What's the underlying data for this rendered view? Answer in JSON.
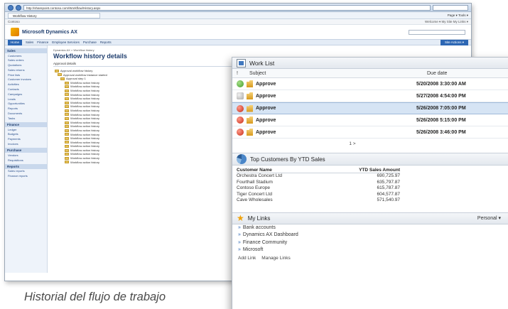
{
  "browser": {
    "address": "http://sharepoint.contoso.com/Workflow/History.aspx",
    "fav_tab": "Workflow History",
    "command_bar": "Page ▾  Tools ▾",
    "top_links": "Contoso",
    "top_right": "Welcome ▾  My Site  My Links ▾"
  },
  "sharepoint": {
    "site_title": "Microsoft Dynamics AX",
    "tabs": [
      "Home",
      "Sales",
      "Finance",
      "Employee Services",
      "Purchase",
      "Reports"
    ],
    "site_actions": "Site Actions ▾",
    "page_title": "Workflow history details",
    "breadcrumb": "Dynamics AX > Workflow history",
    "section_head": "Approval details",
    "side_note": "Approval workflow history",
    "quicklaunch": [
      {
        "head": "Sales",
        "items": [
          "Customers",
          "Sales orders",
          "Quotations",
          "Sales returns",
          "Price lists",
          "Customer invoices",
          "Activities",
          "Contacts",
          "Campaigns",
          "Leads",
          "Opportunities",
          "Reports",
          "Documents",
          "Tasks"
        ]
      },
      {
        "head": "Finance",
        "items": [
          "Ledger",
          "Budgets",
          "Payments",
          "Invoices"
        ]
      },
      {
        "head": "Purchase",
        "items": [
          "Vendors",
          "Requisitions"
        ]
      },
      {
        "head": "Reports",
        "items": [
          "Sales reports",
          "Finance reports"
        ]
      }
    ],
    "tree": [
      "Approval workflow history",
      "Approval workflow instance started",
      "Approval step 1",
      "Workflow action history",
      "Workflow action history",
      "Workflow action history",
      "Workflow action history",
      "Workflow action history",
      "Workflow action history",
      "Workflow action history",
      "Workflow action history",
      "Workflow action history",
      "Workflow action history",
      "Workflow action history",
      "Workflow action history",
      "Workflow action history",
      "Workflow action history",
      "Workflow action history",
      "Workflow action history",
      "Workflow action history",
      "Workflow action history",
      "Workflow action history",
      "Workflow action history",
      "Workflow action history"
    ]
  },
  "work_list": {
    "title": "Work List",
    "col_num": "!",
    "col_subject": "Subject",
    "col_due": "Due date",
    "rows": [
      {
        "status": "green",
        "subject": "Approve",
        "due": "5/20/2008 3:30:00 AM"
      },
      {
        "status": "gray",
        "subject": "Approve",
        "due": "5/27/2008 4:54:00 PM"
      },
      {
        "status": "red",
        "subject": "Approve",
        "due": "5/26/2008 7:05:00 PM",
        "selected": true
      },
      {
        "status": "red",
        "subject": "Approve",
        "due": "5/26/2008 5:15:00 PM"
      },
      {
        "status": "red",
        "subject": "Approve",
        "due": "5/26/2008 3:46:00 PM"
      }
    ],
    "pager": "1 >"
  },
  "top_customers": {
    "title": "Top Customers By YTD Sales",
    "col_name": "Customer Name",
    "col_amount": "YTD Sales Amount",
    "rows": [
      {
        "name": "Orchestra Concert Ltd",
        "amount": "690,725.97"
      },
      {
        "name": "Fourthall Stadium",
        "amount": "635,797.87"
      },
      {
        "name": "Contoso Europe",
        "amount": "615,787.87"
      },
      {
        "name": "Tiger Concert Ltd",
        "amount": "604,577.87"
      },
      {
        "name": "Cave Wholesales",
        "amount": "571,540.97"
      }
    ]
  },
  "my_links": {
    "title": "My Links",
    "personal": "Personal ▾",
    "items": [
      "Bank accounts",
      "Dynamics AX Dashboard",
      "Finance Community",
      "Microsoft"
    ],
    "add_link": "Add Link",
    "manage_links": "Manage Links"
  },
  "caption": "Historial del flujo de trabajo"
}
